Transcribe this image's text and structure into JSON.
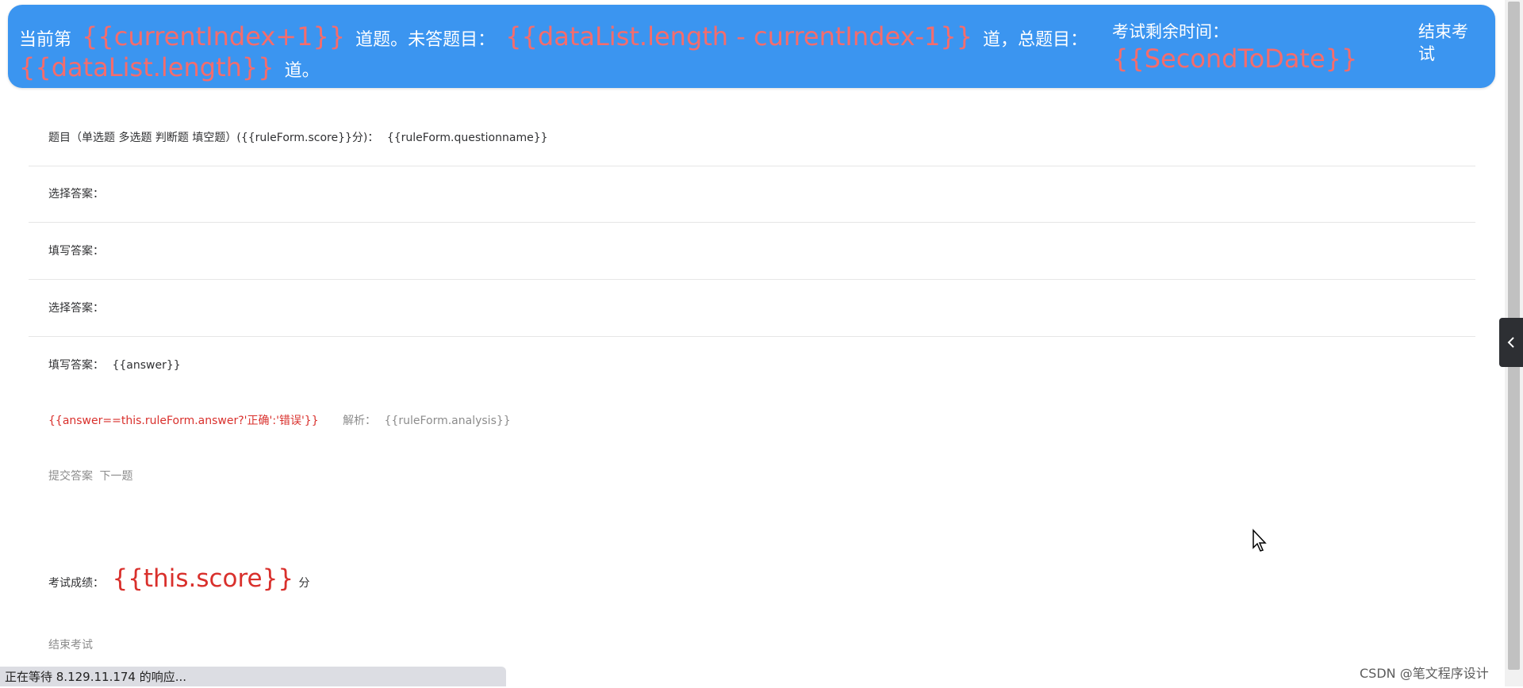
{
  "header": {
    "line1_prefix": "当前第",
    "current_expr": "{{currentIndex+1}}",
    "line1_mid1": "道题。未答题目：",
    "remaining_expr": "{{dataList.length - currentIndex-1}}",
    "line1_mid2": "道，总题目：",
    "total_expr": "{{dataList.length}}",
    "line2_suffix": "道。",
    "timer_label": "考试剩余时间：",
    "timer_value": "{{SecondToDate}}",
    "end_exam_label": "结束考试"
  },
  "question": {
    "type_label": "题目（单选题 多选题 判断题 填空题）",
    "score_expr": "({{ruleForm.score}}分)：",
    "name_expr": "{{ruleForm.questionname}}"
  },
  "rows": {
    "choose_answer_1": "选择答案：",
    "fill_answer_1": "填写答案：",
    "choose_answer_2": "选择答案：",
    "fill_answer_2": "填写答案：",
    "answer_expr": "{{answer}}"
  },
  "result": {
    "judge_expr": "{{answer==this.ruleForm.answer?'正确':'错误'}}",
    "analysis_label": "解析：",
    "analysis_expr": "{{ruleForm.analysis}}"
  },
  "actions": {
    "submit_label": "提交答案",
    "next_label": "下一题"
  },
  "exam_score": {
    "label": "考试成绩：",
    "value": "{{this.score}}",
    "unit": "分"
  },
  "end_exam_link": "结束考试",
  "status_bar": "正在等待 8.129.11.174 的响应...",
  "watermark": "CSDN @笔文程序设计",
  "colors": {
    "header_bg": "#3b95f0",
    "expr_red": "#f56c6c",
    "result_red": "#d9302c"
  },
  "icons": {
    "side_handle": "chevron-left-icon",
    "cursor": "mouse-pointer-icon"
  }
}
